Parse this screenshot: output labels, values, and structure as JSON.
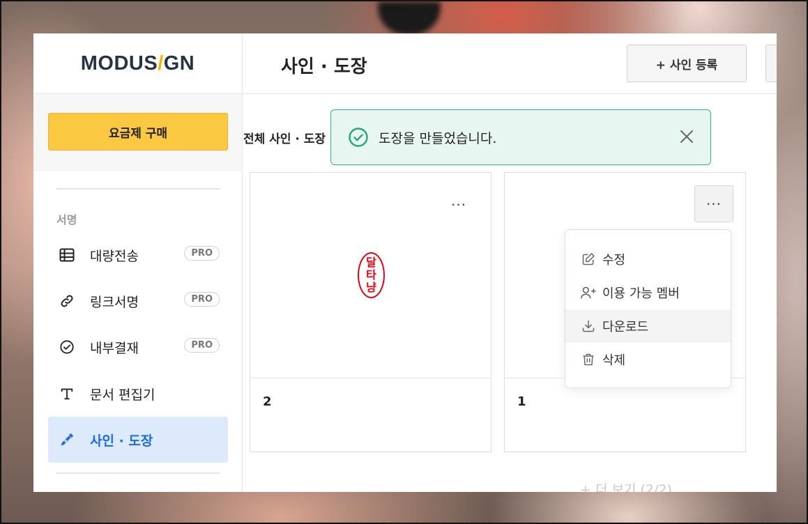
{
  "brand": {
    "logo_left": "MODUS",
    "logo_slash": "/",
    "logo_right": "GN"
  },
  "sidebar": {
    "buy_button": "요금제 구매",
    "section_title": "서명",
    "items": [
      {
        "label": "대량전송",
        "icon": "table-icon",
        "badge": "PRO"
      },
      {
        "label": "링크서명",
        "icon": "link-icon",
        "badge": "PRO"
      },
      {
        "label": "내부결재",
        "icon": "check-circle-icon",
        "badge": "PRO"
      },
      {
        "label": "문서 편집기",
        "icon": "text-icon",
        "badge": ""
      },
      {
        "label": "사인 · 도장",
        "icon": "pen-nib-icon",
        "badge": "",
        "active": true
      }
    ]
  },
  "header": {
    "title": "사인 · 도장",
    "add_sign_button": "+ 사인 등록"
  },
  "main": {
    "all_label": "전체 사인 · 도장",
    "cards": [
      {
        "name": "2",
        "stamp_chars": [
          "달",
          "타",
          "냥"
        ],
        "menu_label": "···"
      },
      {
        "name": "1",
        "menu_label": "···"
      }
    ],
    "more_link": "+ 더 보기 (2/2)"
  },
  "dropdown": {
    "items": [
      {
        "label": "수정",
        "icon": "edit-icon"
      },
      {
        "label": "이용 가능 멤버",
        "icon": "user-plus-icon"
      },
      {
        "label": "다운로드",
        "icon": "download-icon"
      },
      {
        "label": "삭제",
        "icon": "trash-icon"
      }
    ]
  },
  "toast": {
    "message": "도장을 만들었습니다.",
    "icon": "check-circle-icon"
  },
  "colors": {
    "accent_yellow": "#fbc841",
    "active_blue": "#1c6ae4",
    "toast_green": "#2fb58e",
    "stamp_red": "#e60012"
  }
}
